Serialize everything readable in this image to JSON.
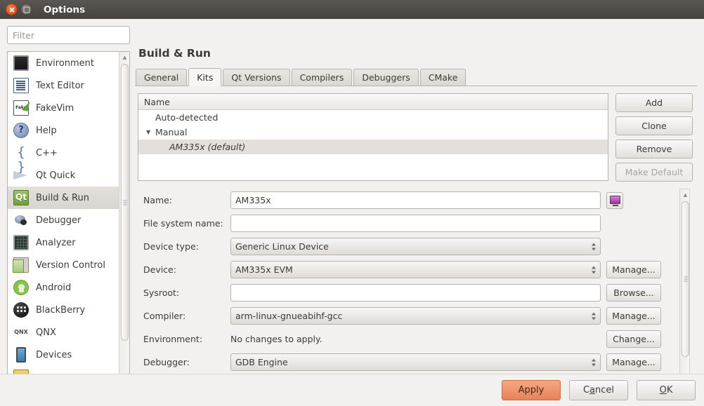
{
  "window": {
    "title": "Options",
    "close_icon": "close-icon",
    "maximize_icon": "maximize-icon"
  },
  "sidebar": {
    "filter_placeholder": "Filter",
    "filter_value": "",
    "items": [
      {
        "label": "Environment",
        "icon": "environment-icon",
        "selected": false
      },
      {
        "label": "Text Editor",
        "icon": "text-editor-icon",
        "selected": false
      },
      {
        "label": "FakeVim",
        "icon": "fakevim-icon",
        "selected": false
      },
      {
        "label": "Help",
        "icon": "help-icon",
        "selected": false
      },
      {
        "label": "C++",
        "icon": "cpp-icon",
        "selected": false
      },
      {
        "label": "Qt Quick",
        "icon": "qtquick-icon",
        "selected": false
      },
      {
        "label": "Build & Run",
        "icon": "build-run-icon",
        "selected": true
      },
      {
        "label": "Debugger",
        "icon": "debugger-icon",
        "selected": false
      },
      {
        "label": "Analyzer",
        "icon": "analyzer-icon",
        "selected": false
      },
      {
        "label": "Version Control",
        "icon": "version-control-icon",
        "selected": false
      },
      {
        "label": "Android",
        "icon": "android-icon",
        "selected": false
      },
      {
        "label": "BlackBerry",
        "icon": "blackberry-icon",
        "selected": false
      },
      {
        "label": "QNX",
        "icon": "qnx-icon",
        "selected": false
      },
      {
        "label": "Devices",
        "icon": "devices-icon",
        "selected": false
      },
      {
        "label": "",
        "icon": "code-pasting-icon",
        "selected": false
      }
    ],
    "qnx_glyph": "QNX",
    "cpp_glyph": "{ }",
    "qt_glyph": "Qt",
    "help_glyph": "?",
    "fakevim_glyph": "Fake"
  },
  "main": {
    "title": "Build & Run",
    "tabs": [
      {
        "label": "General",
        "active": false
      },
      {
        "label": "Kits",
        "active": true
      },
      {
        "label": "Qt Versions",
        "active": false
      },
      {
        "label": "Compilers",
        "active": false
      },
      {
        "label": "Debuggers",
        "active": false
      },
      {
        "label": "CMake",
        "active": false
      }
    ],
    "tree": {
      "header": "Name",
      "expander_glyph": "▼",
      "rows": [
        {
          "label": "Auto-detected",
          "level": 1,
          "expander": false,
          "selected": false,
          "italic": false
        },
        {
          "label": "Manual",
          "level": 1,
          "expander": true,
          "selected": false,
          "italic": false
        },
        {
          "label": "AM335x (default)",
          "level": 2,
          "expander": false,
          "selected": true,
          "italic": true
        }
      ]
    },
    "kit_buttons": [
      {
        "label": "Add",
        "enabled": true
      },
      {
        "label": "Clone",
        "enabled": true
      },
      {
        "label": "Remove",
        "enabled": true
      },
      {
        "label": "Make Default",
        "enabled": false
      }
    ],
    "form": [
      {
        "label": "Name:",
        "type": "input",
        "value": "AM335x",
        "placeholder": "",
        "button": "",
        "icon_button": "device-monitor-icon"
      },
      {
        "label": "File system name:",
        "type": "input",
        "value": "",
        "placeholder": "",
        "button": "",
        "icon_button": ""
      },
      {
        "label": "Device type:",
        "type": "combo",
        "value": "Generic Linux Device",
        "placeholder": "",
        "button": "",
        "icon_button": ""
      },
      {
        "label": "Device:",
        "type": "combo",
        "value": "AM335x EVM",
        "placeholder": "",
        "button": "Manage...",
        "icon_button": ""
      },
      {
        "label": "Sysroot:",
        "type": "input",
        "value": "",
        "placeholder": "",
        "button": "Browse...",
        "icon_button": ""
      },
      {
        "label": "Compiler:",
        "type": "combo",
        "value": "arm-linux-gnueabihf-gcc",
        "placeholder": "",
        "button": "Manage...",
        "icon_button": ""
      },
      {
        "label": "Environment:",
        "type": "static",
        "value": "No changes to apply.",
        "placeholder": "",
        "button": "Change...",
        "icon_button": ""
      },
      {
        "label": "Debugger:",
        "type": "combo",
        "value": "GDB Engine",
        "placeholder": "",
        "button": "Manage...",
        "icon_button": ""
      }
    ]
  },
  "footer": {
    "apply": "Apply",
    "cancel_pre": "C",
    "cancel_mn": "a",
    "cancel_post": "ncel",
    "ok_pre": "",
    "ok_mn": "O",
    "ok_post": "K"
  },
  "colors": {
    "accent": "#e5835a",
    "titlebar": "#4a4642",
    "close_button": "#e0551f",
    "selection": "#e3e0dc",
    "window_bg": "#f2f1f0"
  }
}
